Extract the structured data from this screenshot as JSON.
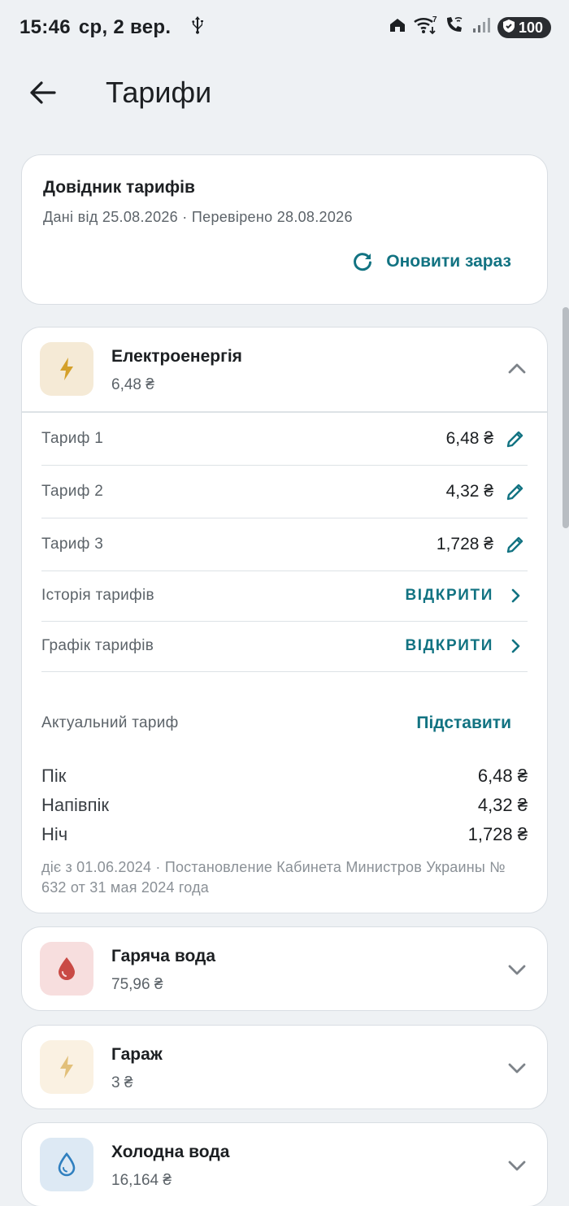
{
  "status_bar": {
    "time": "15:46",
    "date": "ср, 2 вер.",
    "battery": "100",
    "wifi_badge": "7"
  },
  "app_bar": {
    "title": "Тарифи",
    "back_icon": "arrow-left-icon"
  },
  "directory": {
    "title": "Довідник тарифів",
    "subtitle": "Дані від 25.08.2026 · Перевірено 28.08.2026",
    "refresh_label": "Оновити зараз"
  },
  "electricity": {
    "name": "Електроенергія",
    "price": "6,48 ₴",
    "icon": "lightning-icon",
    "icon_color": "#d4a02a",
    "icon_bg": "#f5ead6",
    "rows": [
      {
        "label": "Тариф 1",
        "value": "6,48 ₴"
      },
      {
        "label": "Тариф 2",
        "value": "4,32 ₴"
      },
      {
        "label": "Тариф 3",
        "value": "1,728 ₴"
      }
    ],
    "links": [
      {
        "label": "Історія тарифів",
        "action": "ВІДКРИТИ"
      },
      {
        "label": "Графік тарифів",
        "action": "ВІДКРИТИ"
      }
    ],
    "actual": {
      "label": "Актуальний тариф",
      "action": "Підставити",
      "periods": [
        {
          "name": "Пік",
          "value": "6,48 ₴"
        },
        {
          "name": "Напівпік",
          "value": "4,32 ₴"
        },
        {
          "name": "Ніч",
          "value": "1,728 ₴"
        }
      ],
      "note": "діє з 01.06.2024 · Постановление Кабинета Министров Украины № 632 от 31 мая 2024 года"
    }
  },
  "utilities": [
    {
      "name": "Гаряча вода",
      "price": "75,96 ₴",
      "icon": "drop-filled-icon",
      "icon_color": "#c94a45",
      "icon_bg": "#f7dede"
    },
    {
      "name": "Гараж",
      "price": "3 ₴",
      "icon": "lightning-icon",
      "icon_color": "#e2c07a",
      "icon_bg": "#faf1e2"
    },
    {
      "name": "Холодна вода",
      "price": "16,164 ₴",
      "icon": "drop-outline-icon",
      "icon_color": "#2f7fbf",
      "icon_bg": "#dde9f4"
    }
  ],
  "colors": {
    "accent": "#127382",
    "background": "#eef1f4",
    "card": "#ffffff"
  }
}
